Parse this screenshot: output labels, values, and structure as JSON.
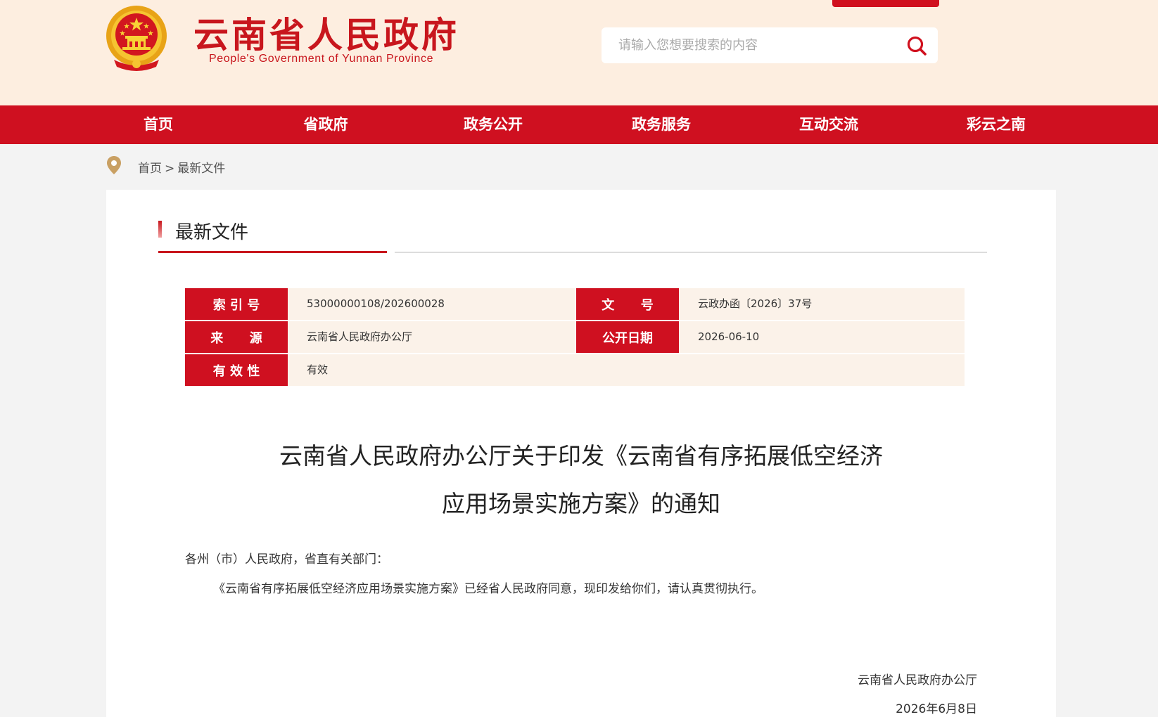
{
  "header": {
    "site_title": "云南省人民政府",
    "site_subtitle": "People's Government of Yunnan Province",
    "search_placeholder": "请输入您想要搜索的内容"
  },
  "nav": {
    "items": [
      "首页",
      "省政府",
      "政务公开",
      "政务服务",
      "互动交流",
      "彩云之南"
    ]
  },
  "breadcrumb": {
    "home": "首页",
    "separator": ">",
    "current": "最新文件"
  },
  "section": {
    "title": "最新文件"
  },
  "meta": {
    "index_label": "索 引 号",
    "index_value": "53000000108/202600028",
    "doc_no_label": "文      号",
    "doc_no_value": "云政办函〔2026〕37号",
    "source_label": "来      源",
    "source_value": "云南省人民政府办公厅",
    "publish_date_label": "公开日期",
    "publish_date_value": "2026-06-10",
    "validity_label": "有 效 性",
    "validity_value": "有效"
  },
  "document": {
    "title_line1": "云南省人民政府办公厅关于印发《云南省有序拓展低空经济",
    "title_line2": "应用场景实施方案》的通知",
    "salutation": "各州（市）人民政府，省直有关部门：",
    "body": "《云南省有序拓展低空经济应用场景实施方案》已经省人民政府同意，现印发给你们，请认真贯彻执行。",
    "signoff_org": "云南省人民政府办公厅",
    "signoff_date": "2026年6月8日"
  },
  "colors": {
    "brand_red": "#cf1020",
    "header_bg": "#fdeee0",
    "meta_row_bg": "#fbf2e9"
  },
  "icons": {
    "emblem": "national-emblem-icon",
    "search": "search-icon",
    "location": "location-pin-icon"
  }
}
